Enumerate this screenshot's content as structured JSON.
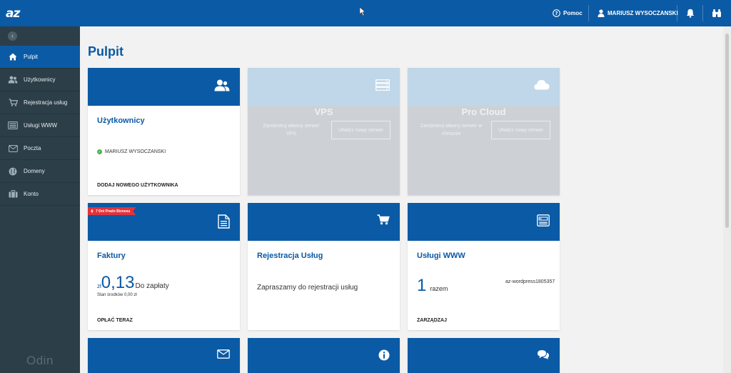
{
  "topbar": {
    "logo": "az",
    "help_label": "Pomoc",
    "user_name": "MARIUSZ WYSOCZANSKI",
    "bell_icon": "bell-icon",
    "binoculars_icon": "binoculars-icon"
  },
  "sidebar": {
    "collapse_symbol": "‹",
    "items": [
      {
        "label": "Pulpit",
        "icon": "home-icon",
        "active": true
      },
      {
        "label": "Użytkownicy",
        "icon": "users-icon"
      },
      {
        "label": "Rejestracja usług",
        "icon": "cart-icon"
      },
      {
        "label": "Usługi WWW",
        "icon": "web-services-icon"
      },
      {
        "label": "Poczta",
        "icon": "mail-icon"
      },
      {
        "label": "Domeny",
        "icon": "globe-icon"
      },
      {
        "label": "Konto",
        "icon": "briefcase-icon"
      }
    ],
    "footer_logo": "Odin"
  },
  "main": {
    "page_title": "Pulpit",
    "cards": {
      "users": {
        "title": "Użytkownicy",
        "user": "MARIUSZ WYSOCZANSKI",
        "footer": "DODAJ NOWEGO UŻYTKOWNIKA"
      },
      "vps": {
        "title": "VPS",
        "text": "Zarejestruj własny serwer VPS",
        "button": "Utwórz nowy serwer"
      },
      "procloud": {
        "title": "Pro Cloud",
        "text": "Zarejestruj własny serwer w chmurze",
        "button": "Utwórz nowy serwer"
      },
      "invoices": {
        "ribbon": "7 Dni Prado Biznesu",
        "title": "Faktury",
        "currency": "zł",
        "amount": "0,13",
        "amount_label": "Do zapłaty",
        "balance": "Stan środków 0,00 zł",
        "footer": "OPŁAĆ TERAZ"
      },
      "registration": {
        "title": "Rejestracja Usług",
        "text": "Zapraszamy do rejestracji usług"
      },
      "web": {
        "title": "Usługi WWW",
        "count": "1",
        "count_label": "razem",
        "domain": "az-wordpress1805357",
        "footer": "ZARZĄDZAJ"
      }
    }
  },
  "colors": {
    "primary": "#0b5aa5",
    "sidebar_bg": "#2c3e48",
    "disabled_card": "#cdd1d6",
    "disabled_head": "#bfd7e9",
    "ribbon": "#e2323c",
    "status_ok": "#4caf50"
  }
}
